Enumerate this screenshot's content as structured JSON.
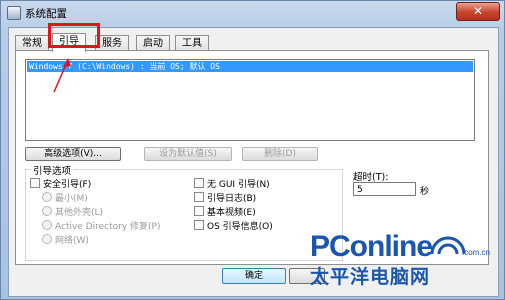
{
  "window": {
    "title": "系统配置",
    "close_glyph": "✕"
  },
  "tabs": [
    {
      "label": "常规"
    },
    {
      "label": "引导"
    },
    {
      "label": "服务"
    },
    {
      "label": "启动"
    },
    {
      "label": "工具"
    }
  ],
  "os_list": {
    "items": [
      "Windows 7 (C:\\Windows) : 当前 OS; 默认 OS"
    ]
  },
  "buttons": {
    "advanced": "高级选项(V)...",
    "set_default": "设为默认值(S)",
    "delete": "删除(D)",
    "ok": "确定"
  },
  "boot_options": {
    "title": "引导选项",
    "safe_boot": "安全引导(F)",
    "minimal": "最小(M)",
    "alternate_shell": "其他外壳(L)",
    "active_directory": "Active Directory 修复(P)",
    "network": "网络(W)",
    "no_gui": "无 GUI 引导(N)",
    "boot_log": "引导日志(B)",
    "base_video": "基本视频(E)",
    "os_boot_info": "OS 引导信息(O)"
  },
  "timeout": {
    "label": "超时(T):",
    "value": "5",
    "unit": "秒"
  },
  "colors": {
    "annotation": "#e8101b",
    "selection": "#3399ff",
    "watermark": "#1a56b0"
  },
  "watermark": {
    "brand": "PConline",
    "domain": ".com.cn",
    "subtitle": "太平洋电脑网"
  }
}
